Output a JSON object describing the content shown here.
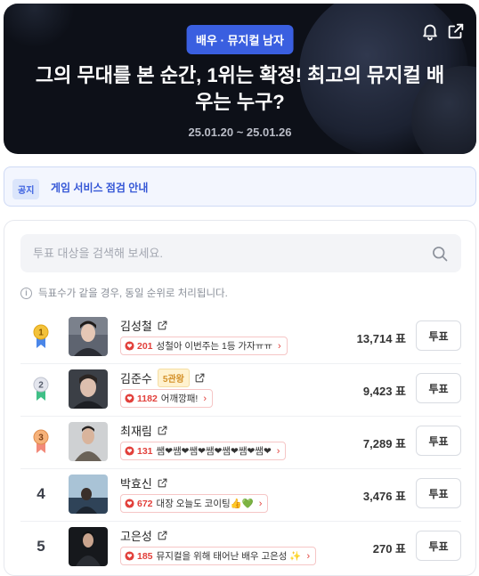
{
  "hero": {
    "category_badge": "배우 · 뮤지컬 남자",
    "title": "그의 무대를 본 순간, 1위는 확정! 최고의 뮤지컬 배우는 누구?",
    "date_range": "25.01.20 ~ 25.01.26",
    "icons": [
      "bell-icon",
      "share-icon"
    ]
  },
  "notice": {
    "tag": "공지",
    "text": "게임 서비스 점검 안내"
  },
  "search": {
    "placeholder": "투표 대상을 검색해 보세요.",
    "value": ""
  },
  "hint": "득표수가 같을 경우, 동일 순위로 처리됩니다.",
  "vote_unit": "표",
  "vote_button_label": "투표",
  "colors": {
    "accent": "#3a5fe0",
    "heart": "#e2403b",
    "hero_bg": "#0d1018"
  },
  "ranking": [
    {
      "rank": "1",
      "medal": "gold",
      "name": "김성철",
      "badge": "",
      "cheer_count": "201",
      "cheer_msg": "성철아 이번주는 1등 가자ㅠㅠ",
      "votes": "13,714 표"
    },
    {
      "rank": "2",
      "medal": "silver",
      "name": "김준수",
      "badge": "5관왕",
      "cheer_count": "1182",
      "cheer_msg": "어깨깡패!",
      "votes": "9,423 표"
    },
    {
      "rank": "3",
      "medal": "bronze",
      "name": "최재림",
      "badge": "",
      "cheer_count": "131",
      "cheer_msg": "쌤❤쌤❤쌤❤쌤❤쌤❤쌤❤쌤❤",
      "votes": "7,289 표"
    },
    {
      "rank": "4",
      "medal": "",
      "name": "박효신",
      "badge": "",
      "cheer_count": "672",
      "cheer_msg": "대장 오늘도 코이팅👍💚",
      "votes": "3,476 표"
    },
    {
      "rank": "5",
      "medal": "",
      "name": "고은성",
      "badge": "",
      "cheer_count": "185",
      "cheer_msg": "뮤지컬을 위해 태어난 배우 고은성 ✨",
      "votes": "270 표"
    }
  ]
}
